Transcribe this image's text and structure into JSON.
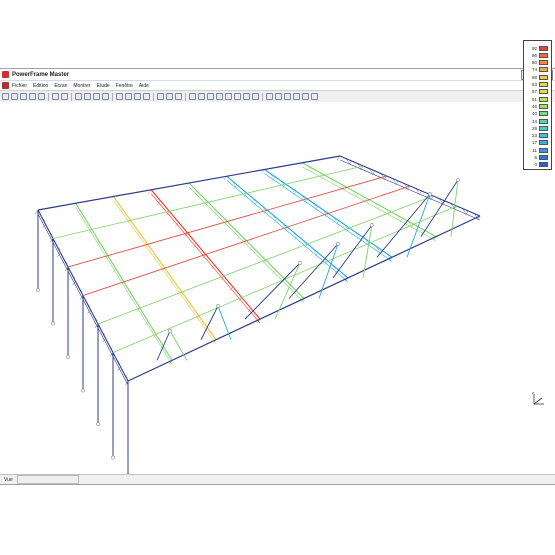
{
  "window": {
    "title": "PowerFrame Master"
  },
  "menu": {
    "items": [
      "Fichier",
      "Edition",
      "Ecran",
      "Montrer",
      "Etude",
      "Fenêtre",
      "Aide"
    ]
  },
  "toolbar": {
    "icons": [
      "new-file-icon",
      "open-file-icon",
      "save-icon",
      "print-icon",
      "preview-icon",
      "undo-icon",
      "redo-icon",
      "list-icon",
      "text-icon",
      "grid-icon",
      "grid-alt-icon",
      "zoom-in-icon",
      "rotate-icon",
      "zoom-out-icon",
      "zoom-fit-icon",
      "node-g-icon",
      "node-g-alt-icon",
      "pan-icon",
      "view-icon",
      "beam-icon",
      "column-icon",
      "truss-icon",
      "section-icon",
      "load-icon",
      "support-icon",
      "check-icon",
      "calc-icon",
      "results-icon",
      "table-icon",
      "report-icon",
      "export-icon",
      "doc-icon"
    ]
  },
  "legend": {
    "values": [
      "92",
      "86",
      "80",
      "74",
      "68",
      "63",
      "57",
      "51",
      "46",
      "40",
      "34",
      "29",
      "23",
      "17",
      "11",
      "6",
      "0"
    ],
    "colors": [
      "#e8433a",
      "#f26b3a",
      "#f58b3c",
      "#f8a84a",
      "#f5c24d",
      "#e9d34e",
      "#d6e04a",
      "#b8e64a",
      "#93e75a",
      "#6ee07c",
      "#52d8a2",
      "#46cfc0",
      "#3fc4d8",
      "#3aaee2",
      "#3592e6",
      "#2f76e4",
      "#2b5fd8"
    ]
  },
  "status": {
    "text": "Vue"
  },
  "structure": {
    "colors": {
      "frame": "#2c3c8c",
      "truss_low": "#22a9d4",
      "truss_mid": "#7fd36a",
      "truss_high": "#e6c43f",
      "truss_max": "#e53b2f",
      "support": "#8b8b8b"
    }
  }
}
